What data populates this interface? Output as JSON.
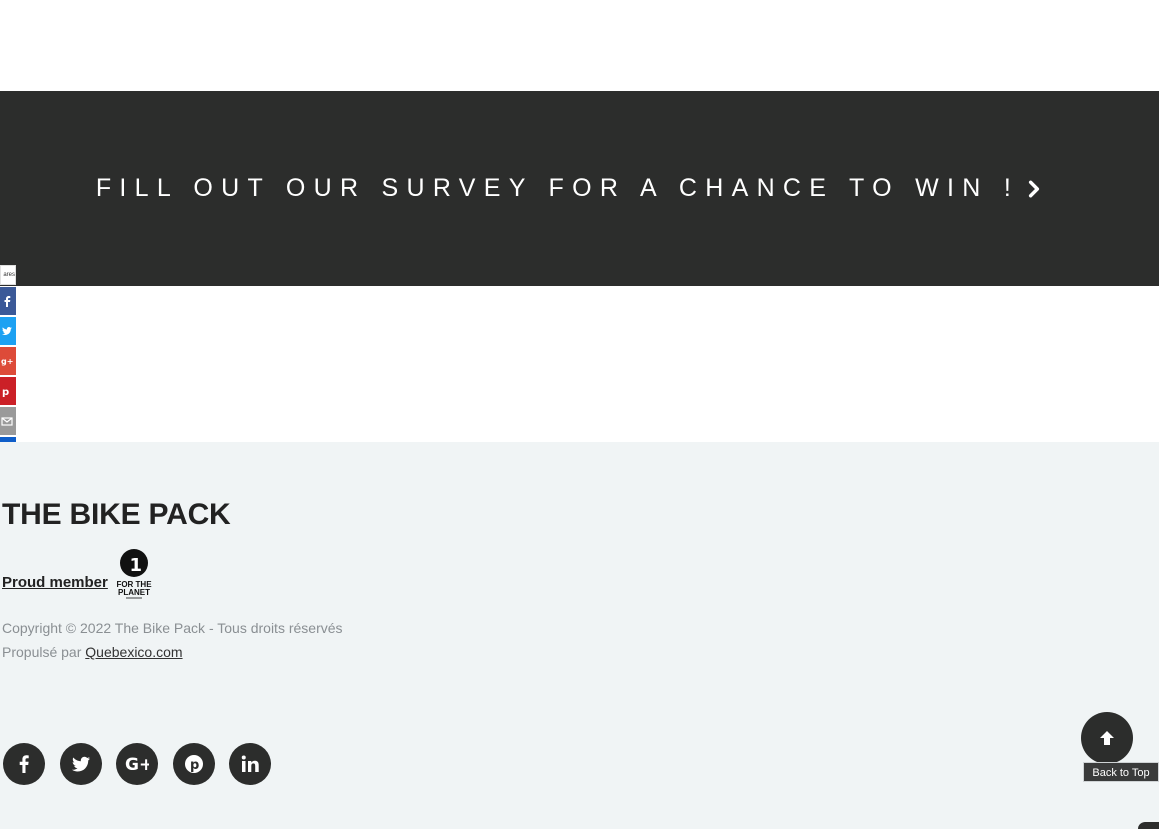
{
  "survey": {
    "text": "FILL OUT OUR SURVEY FOR A CHANCE TO WIN !",
    "bg_color": "#2c2d2c"
  },
  "share_bar": {
    "count_label": "ares",
    "buttons": [
      {
        "name": "facebook",
        "icon": "facebook-icon",
        "color": "#3b5998"
      },
      {
        "name": "twitter",
        "icon": "twitter-icon",
        "color": "#1da1f2"
      },
      {
        "name": "google-plus",
        "icon": "google-plus-icon",
        "color": "#dd4b39"
      },
      {
        "name": "pinterest",
        "icon": "pinterest-icon",
        "color": "#cb2027"
      },
      {
        "name": "email",
        "icon": "email-icon",
        "color": "#9a9a9a"
      },
      {
        "name": "sumome",
        "icon": "crown-icon",
        "color": "#0f5ec9"
      }
    ]
  },
  "footer": {
    "brand": "THE BIKE PACK",
    "proud_label": "Proud member",
    "planet_logo_text": "FOR THE PLANET",
    "copyright": "Copyright © 2022 The Bike Pack - Tous droits réservés",
    "powered_prefix": "Propulsé par ",
    "powered_link": "Quebexico.com",
    "social": [
      {
        "name": "facebook",
        "icon": "facebook-icon"
      },
      {
        "name": "twitter",
        "icon": "twitter-icon"
      },
      {
        "name": "google-plus",
        "icon": "google-plus-icon"
      },
      {
        "name": "pinterest",
        "icon": "pinterest-icon"
      },
      {
        "name": "linkedin",
        "icon": "linkedin-icon"
      }
    ]
  },
  "back_to_top": {
    "label": "Back to Top",
    "icon": "arrow-up-icon"
  }
}
